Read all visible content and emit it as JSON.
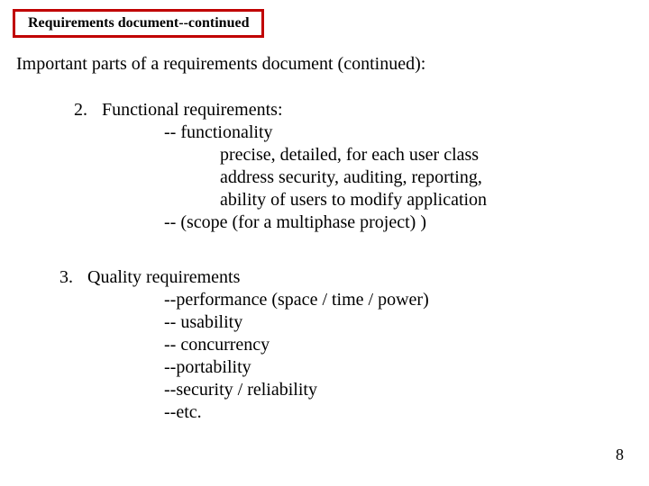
{
  "header": "Requirements document--continued",
  "intro": "Important parts of a requirements document (continued):",
  "section2": {
    "num": "2.",
    "title": "Functional requirements:",
    "sub_a": "-- functionality",
    "detail_1": "precise, detailed, for each user class",
    "detail_2": "address security, auditing, reporting,",
    "detail_3": "ability of users to modify application",
    "sub_b": "-- (scope (for a multiphase project) )"
  },
  "section3": {
    "num": "3.",
    "title": "Quality requirements",
    "line_1": "--performance (space / time / power)",
    "line_2": "-- usability",
    "line_3": "-- concurrency",
    "line_4": "--portability",
    "line_5": "--security / reliability",
    "line_6": "--etc."
  },
  "page_number": "8"
}
